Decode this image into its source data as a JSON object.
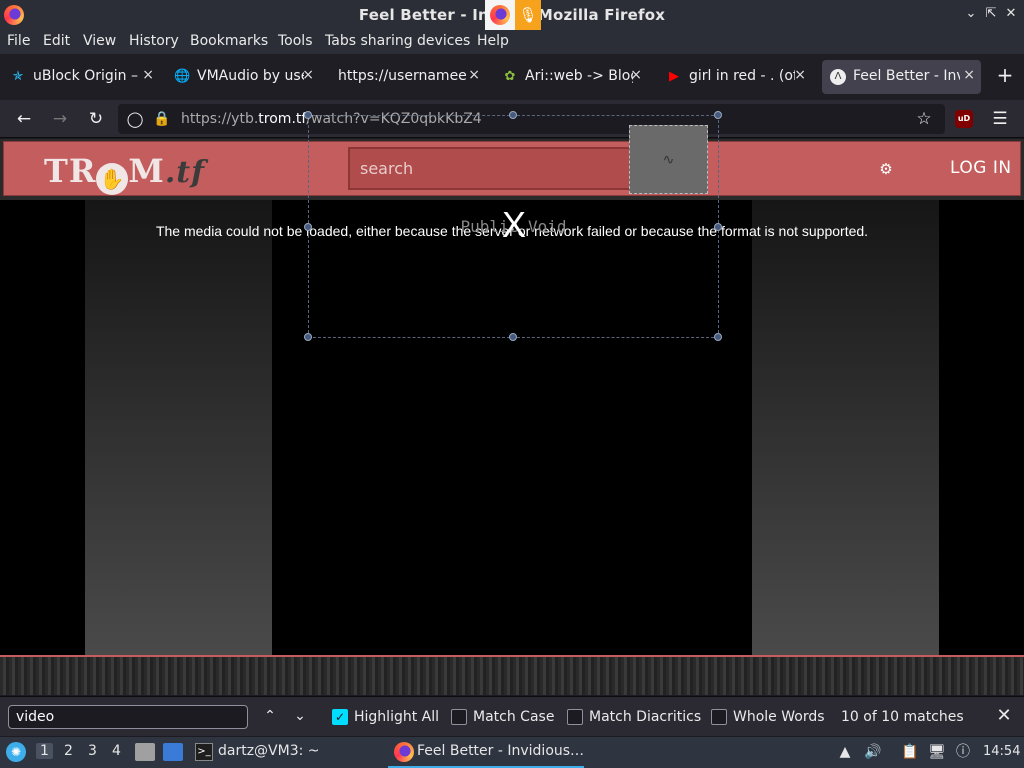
{
  "window": {
    "title": "Feel Better - Invi… – Mozilla Firefox",
    "controls": [
      "minimize",
      "restore",
      "close"
    ]
  },
  "menubar": [
    "File",
    "Edit",
    "View",
    "History",
    "Bookmarks",
    "Tools",
    "Tabs sharing devices",
    "Help"
  ],
  "tabs": [
    {
      "label": "uBlock Origin – ",
      "icon": "ublock-icon",
      "active": false
    },
    {
      "label": "VMAudio by use",
      "icon": "globe-icon",
      "active": false
    },
    {
      "label": "https://usernameer",
      "icon": "",
      "active": false
    },
    {
      "label": "Ari::web -> Blog",
      "icon": "leaf-icon",
      "active": false
    },
    {
      "label": "girl in red - . (off",
      "icon": "youtube-icon",
      "active": false
    },
    {
      "label": "Feel Better - Inv",
      "icon": "invidious-icon",
      "active": true
    }
  ],
  "navbar": {
    "url_prefix": "https://ytb.",
    "url_domain": "trom.tf",
    "url_suffix": "/watch?v=KQZ0qbkKbZ4",
    "extension_badge": "uD"
  },
  "site": {
    "logo_main": "TR",
    "logo_after": "M",
    "logo_tld": ".tf",
    "search_placeholder": "search",
    "login_label": "LOG IN",
    "accent_color": "#c45d5d"
  },
  "player": {
    "error_message": "The media could not be loaded, either because the server or network failed or because the format is not supported.",
    "poster_text": "Public Void",
    "poster_mark": "X"
  },
  "findbar": {
    "query": "video",
    "options": [
      {
        "label": "Highlight All",
        "checked": true
      },
      {
        "label": "Match Case",
        "checked": false
      },
      {
        "label": "Match Diacritics",
        "checked": false
      },
      {
        "label": "Whole Words",
        "checked": false
      }
    ],
    "match_status": "10 of 10 matches"
  },
  "taskbar": {
    "workspaces": [
      "1",
      "2",
      "3",
      "4"
    ],
    "active_workspace": "1",
    "terminal_label": "dartz@VM3: ~",
    "firefox_label": "Feel Better - Invidious…",
    "clock": "14:54"
  }
}
